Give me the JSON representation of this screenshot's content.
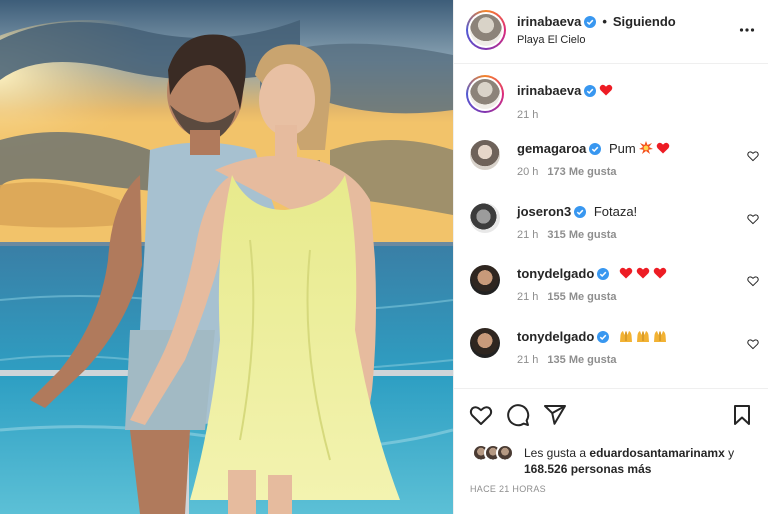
{
  "post": {
    "author": "irinabaeva",
    "separator": "•",
    "follow_status": "Siguiendo",
    "location": "Playa El Cielo"
  },
  "caption": {
    "author": "irinabaeva",
    "emoji": "red-heart",
    "time": "21 h"
  },
  "comments": [
    {
      "user": "gemagaroa",
      "verified": true,
      "text": "Pum",
      "emojis": [
        "collision",
        "red-heart"
      ],
      "time": "20 h",
      "likes": "173 Me gusta"
    },
    {
      "user": "joseron3",
      "verified": true,
      "text": "Fotaza!",
      "emojis": [],
      "time": "21 h",
      "likes": "315 Me gusta"
    },
    {
      "user": "tonydelgado",
      "verified": true,
      "text": "",
      "emojis": [
        "red-heart",
        "red-heart",
        "red-heart"
      ],
      "time": "21 h",
      "likes": "155 Me gusta"
    },
    {
      "user": "tonydelgado",
      "verified": true,
      "text": "",
      "emojis": [
        "raising-hands",
        "raising-hands",
        "raising-hands"
      ],
      "time": "21 h",
      "likes": "135 Me gusta"
    }
  ],
  "likes": {
    "prefix": "Les gusta a",
    "first_user": "eduardosantamarinamx",
    "connector": "y",
    "others": "168.526 personas más"
  },
  "timestamp": "HACE 21 HORAS",
  "icons": {
    "like": "heart-outline-icon",
    "comment": "speech-bubble-icon",
    "share": "paper-plane-icon",
    "save": "bookmark-icon",
    "more": "ellipsis-icon"
  },
  "colors": {
    "verified": "#3897f0",
    "heart": "#ed1c24",
    "text": "#262626",
    "muted": "#8e8e8e",
    "dress": "#eef0a0"
  }
}
